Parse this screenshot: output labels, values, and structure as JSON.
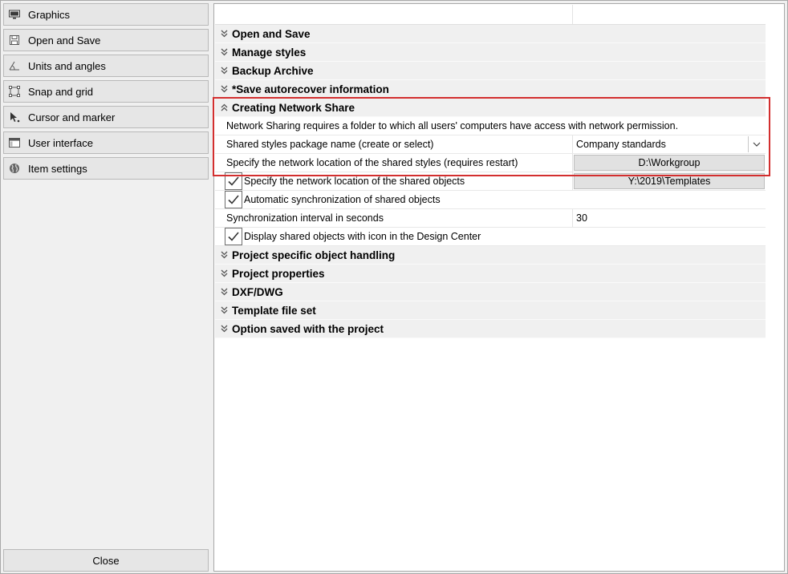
{
  "sidebar": {
    "items": [
      {
        "label": "Graphics",
        "icon": "monitor-icon"
      },
      {
        "label": "Open and Save",
        "icon": "floppy-icon"
      },
      {
        "label": "Units and angles",
        "icon": "angle-icon"
      },
      {
        "label": "Snap and grid",
        "icon": "snap-icon"
      },
      {
        "label": "Cursor and marker",
        "icon": "cursor-icon"
      },
      {
        "label": "User interface",
        "icon": "window-icon"
      },
      {
        "label": "Item settings",
        "icon": "globe-icon"
      }
    ],
    "close_label": "Close"
  },
  "sections": {
    "open_save": "Open and Save",
    "manage_styles": "Manage styles",
    "backup_archive": "Backup Archive",
    "autorecover": "*Save autorecover information",
    "network_share": "Creating Network Share",
    "project_specific": "Project specific object handling",
    "project_properties": "Project properties",
    "dxf_dwg": "DXF/DWG",
    "template_file_set": "Template file set",
    "option_saved": "Option saved with the project"
  },
  "network": {
    "info": "Network Sharing requires a folder to which all users' computers have access with network permission.",
    "package_name_label": "Shared styles package name (create or select)",
    "package_name_value": "Company standards",
    "location_styles_label": "Specify the network location of the shared styles (requires restart)",
    "location_styles_value": "D:\\Workgroup",
    "location_objects_label": "Specify the network location of the shared objects",
    "location_objects_value": "Y:\\2019\\Templates",
    "location_objects_checked": true,
    "auto_sync_label": "Automatic synchronization of shared objects",
    "auto_sync_checked": true,
    "sync_interval_label": "Synchronization interval in seconds",
    "sync_interval_value": "30",
    "display_icon_label": "Display shared objects with icon in the Design Center",
    "display_icon_checked": true
  },
  "colors": {
    "highlight": "#d32f2f",
    "section_bg": "#f0f0f0"
  }
}
